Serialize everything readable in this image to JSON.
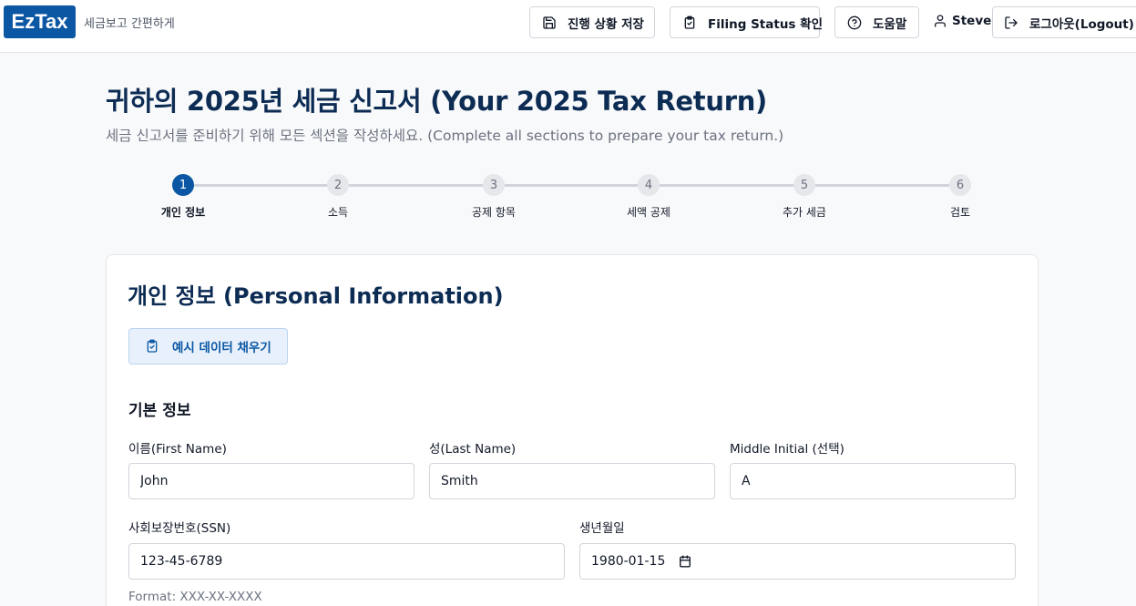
{
  "header": {
    "logo": "EzTax",
    "tagline": "세금보고 간편하게",
    "save_progress": "진행 상황 저장",
    "filing_status": "Filing Status 확인",
    "help": "도움말",
    "user_name": "Steve",
    "logout": "로그아웃(Logout)"
  },
  "page": {
    "title": "귀하의 2025년 세금 신고서 (Your 2025 Tax Return)",
    "subtitle": "세금 신고서를 준비하기 위해 모든 섹션을 작성하세요. (Complete all sections to prepare your tax return.)"
  },
  "steps": [
    {
      "number": "1",
      "label": "개인 정보",
      "active": true
    },
    {
      "number": "2",
      "label": "소득",
      "active": false
    },
    {
      "number": "3",
      "label": "공제 항목",
      "active": false
    },
    {
      "number": "4",
      "label": "세액 공제",
      "active": false
    },
    {
      "number": "5",
      "label": "추가 세금",
      "active": false
    },
    {
      "number": "6",
      "label": "검토",
      "active": false
    }
  ],
  "form": {
    "title": "개인 정보 (Personal Information)",
    "fill_example": "예시 데이터 채우기",
    "section_basic": "기본 정보",
    "first_name_label": "이름(First Name)",
    "first_name_value": "John",
    "last_name_label": "성(Last Name)",
    "last_name_value": "Smith",
    "middle_initial_label": "Middle Initial (선택)",
    "middle_initial_value": "A",
    "ssn_label": "사회보장번호(SSN)",
    "ssn_value": "123-45-6789",
    "ssn_hint": "Format: XXX-XX-XXXX",
    "dob_label": "생년월일",
    "dob_value": "1980-01-15"
  },
  "colors": {
    "brand": "#0b57a4",
    "title": "#0d2c54",
    "step_active": "#0b57a4",
    "step_inactive": "#e5e7eb"
  }
}
